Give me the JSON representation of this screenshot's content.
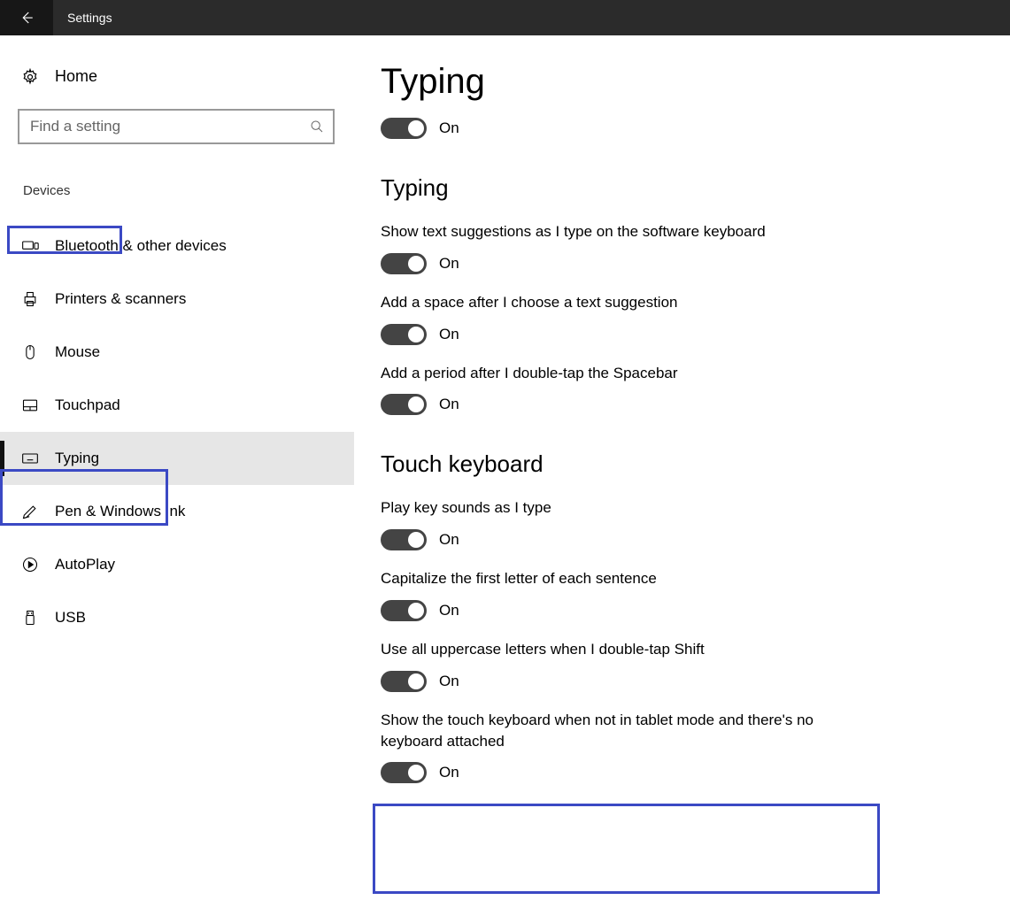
{
  "titlebar": {
    "title": "Settings"
  },
  "sidebar": {
    "home": "Home",
    "search_placeholder": "Find a setting",
    "category": "Devices",
    "items": [
      {
        "label": "Bluetooth & other devices"
      },
      {
        "label": "Printers & scanners"
      },
      {
        "label": "Mouse"
      },
      {
        "label": "Touchpad"
      },
      {
        "label": "Typing"
      },
      {
        "label": "Pen & Windows Ink"
      },
      {
        "label": "AutoPlay"
      },
      {
        "label": "USB"
      }
    ]
  },
  "main": {
    "page_title": "Typing",
    "top_toggle_state": "On",
    "sections": {
      "typing": {
        "title": "Typing",
        "s1": {
          "label": "Show text suggestions as I type on the software keyboard",
          "state": "On"
        },
        "s2": {
          "label": "Add a space after I choose a text suggestion",
          "state": "On"
        },
        "s3": {
          "label": "Add a period after I double-tap the Spacebar",
          "state": "On"
        }
      },
      "touch": {
        "title": "Touch keyboard",
        "s1": {
          "label": "Play key sounds as I type",
          "state": "On"
        },
        "s2": {
          "label": "Capitalize the first letter of each sentence",
          "state": "On"
        },
        "s3": {
          "label": "Use all uppercase letters when I double-tap Shift",
          "state": "On"
        },
        "s4": {
          "label": "Show the touch keyboard when not in tablet mode and there's no keyboard attached",
          "state": "On"
        }
      }
    }
  }
}
